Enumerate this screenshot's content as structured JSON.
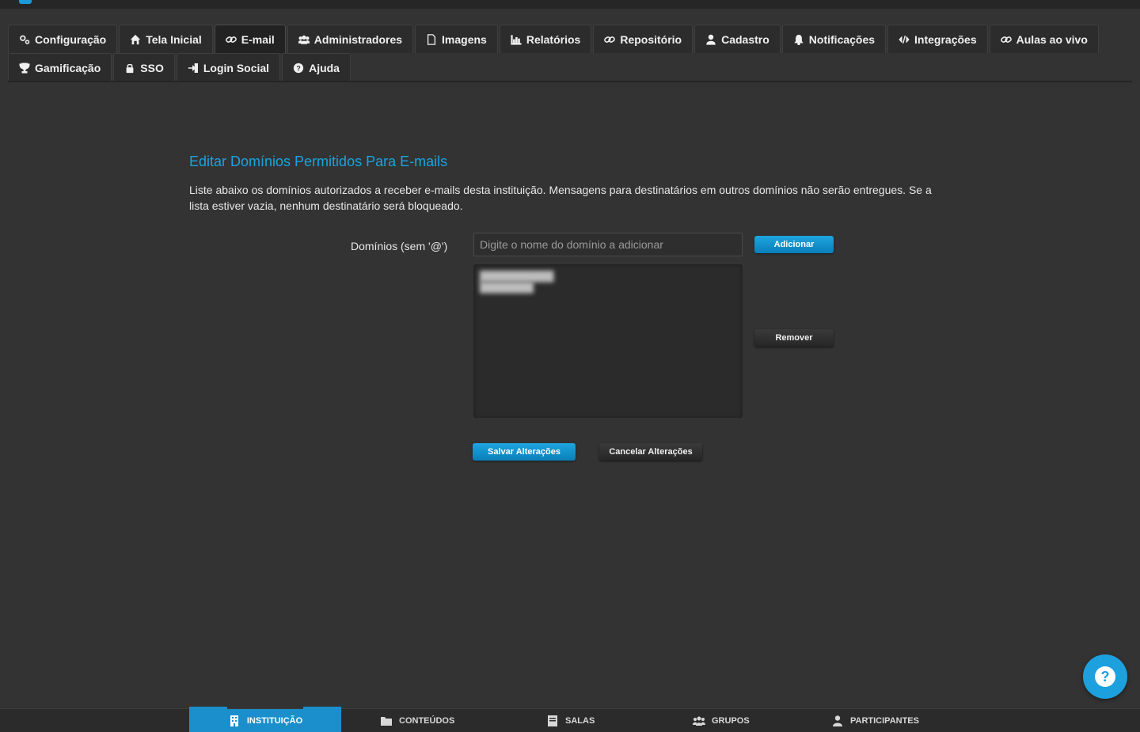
{
  "tabs_row1": [
    {
      "label": "Configuração",
      "icon": "gears-icon"
    },
    {
      "label": "Tela Inicial",
      "icon": "home-icon"
    },
    {
      "label": "E-mail",
      "icon": "link-icon",
      "active": true
    },
    {
      "label": "Administradores",
      "icon": "users-icon"
    },
    {
      "label": "Imagens",
      "icon": "file-icon"
    },
    {
      "label": "Relatórios",
      "icon": "bar-chart-icon"
    },
    {
      "label": "Repositório",
      "icon": "link-icon"
    },
    {
      "label": "Cadastro",
      "icon": "user-icon"
    },
    {
      "label": "Notificações",
      "icon": "bell-icon"
    },
    {
      "label": "Integrações",
      "icon": "code-icon"
    },
    {
      "label": "Aulas ao vivo",
      "icon": "link-icon"
    }
  ],
  "tabs_row2": [
    {
      "label": "Gamificação",
      "icon": "trophy-icon"
    },
    {
      "label": "SSO",
      "icon": "lock-icon"
    },
    {
      "label": "Login Social",
      "icon": "sign-in-icon"
    },
    {
      "label": "Ajuda",
      "icon": "question-icon"
    }
  ],
  "section": {
    "title": "Editar Domínios Permitidos Para E-mails",
    "description": "Liste abaixo os domínios autorizados a receber e-mails desta instituição. Mensagens para destinatários em outros domínios não serão entregues. Se a lista estiver vazia, nenhum destinatário será bloqueado."
  },
  "form": {
    "field_label": "Domínios (sem '@')",
    "input_placeholder": "Digite o nome do domínio a adicionar",
    "input_value": "",
    "add_label": "Adicionar",
    "remove_label": "Remover",
    "save_label": "Salvar Alterações",
    "cancel_label": "Cancelar Alterações"
  },
  "bottom_nav": [
    {
      "label": "Instituição",
      "icon": "building-icon",
      "active": true
    },
    {
      "label": "Conteúdos",
      "icon": "folder-icon"
    },
    {
      "label": "Salas",
      "icon": "book-icon"
    },
    {
      "label": "Grupos",
      "icon": "users-icon"
    },
    {
      "label": "Participantes",
      "icon": "user-icon"
    }
  ],
  "help_fab_glyph": "?",
  "colors": {
    "accent": "#1ba3df",
    "background": "#333333",
    "tab_bg": "#2c2c2c"
  }
}
